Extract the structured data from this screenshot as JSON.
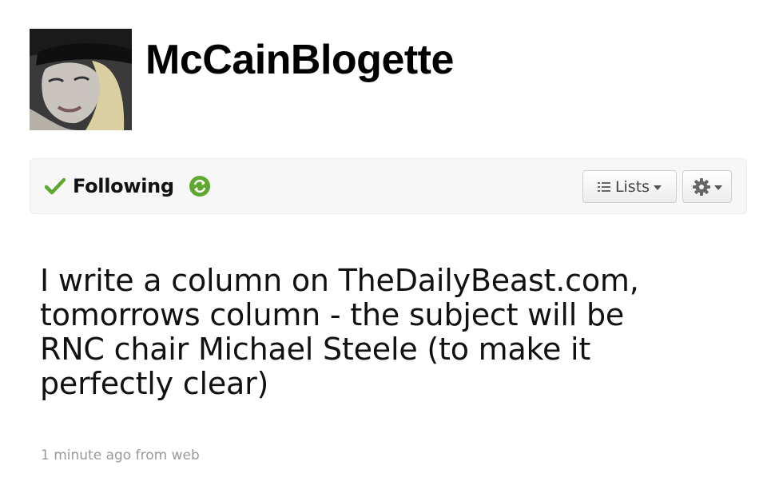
{
  "profile": {
    "username": "McCainBlogette",
    "bio": "I write a column on TheDailyBeast.com, tomorrows column - the subject will be RNC chair Michael Steele (to make it perfectly clear)"
  },
  "action_bar": {
    "follow_status": "Following",
    "lists_label": "Lists",
    "icons": [
      "check-icon",
      "retweet-icon",
      "list-icon",
      "gear-icon",
      "chevron-down-icon"
    ]
  },
  "tweet_meta": {
    "time": "1 minute ago",
    "from_word": "from",
    "source": "web"
  },
  "colors": {
    "follow_green": "#5fa82f",
    "meta_gray": "#999999",
    "bar_background": "#f7f7f7"
  }
}
